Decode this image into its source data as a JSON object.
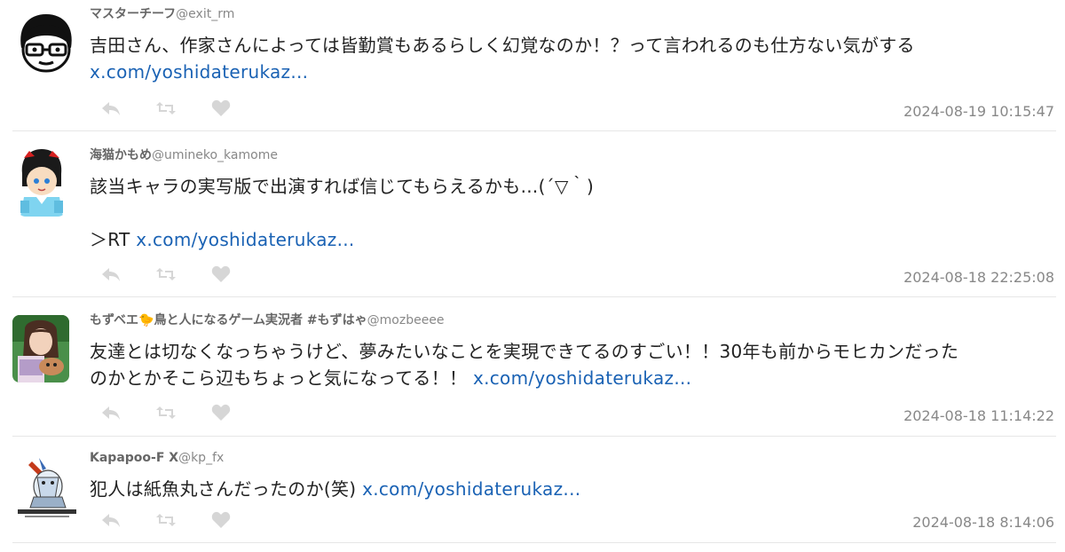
{
  "tweets": [
    {
      "name": "マスターチーフ",
      "handle": "@exit_rm",
      "text": "吉田さん、作家さんによっては皆勤賞もあるらしく幻覚なのか！？って言われるのも仕方ない気がする",
      "link": "x.com/yoshidaterukaz...",
      "time": "2024-08-19 10:15:47"
    },
    {
      "name": "海猫かもめ",
      "handle": "@umineko_kamome",
      "text": "該当キャラの実写版で出演すれば信じてもらえるかも...(´▽｀)",
      "rt_prefix": "＞RT ",
      "link": "x.com/yoshidaterukaz...",
      "time": "2024-08-18 22:25:08"
    },
    {
      "name": "もずベエ🐤鳥と人になるゲーム実況者 #もずはゃ",
      "handle": "@mozbeeee",
      "text_line1": "友達とは切なくなっちゃうけど、夢みたいなことを実現できてるのすごい！！30年も前からモヒカンだった",
      "text_line2": "のかとかそこら辺もちょっと気になってる！！ ",
      "link": "x.com/yoshidaterukaz...",
      "time": "2024-08-18 11:14:22"
    },
    {
      "name": "Kapapoo-F X",
      "handle": "@kp_fx",
      "text": "犯人は紙魚丸さんだったのか(笑) ",
      "link": "x.com/yoshidaterukaz...",
      "time": "2024-08-18 8:14:06"
    }
  ],
  "icons": {
    "reply": "reply-icon",
    "retweet": "retweet-icon",
    "like": "heart-icon"
  },
  "colors": {
    "link": "#1a62b4",
    "action_icon": "#d6d6d6",
    "timestamp": "#888888"
  }
}
